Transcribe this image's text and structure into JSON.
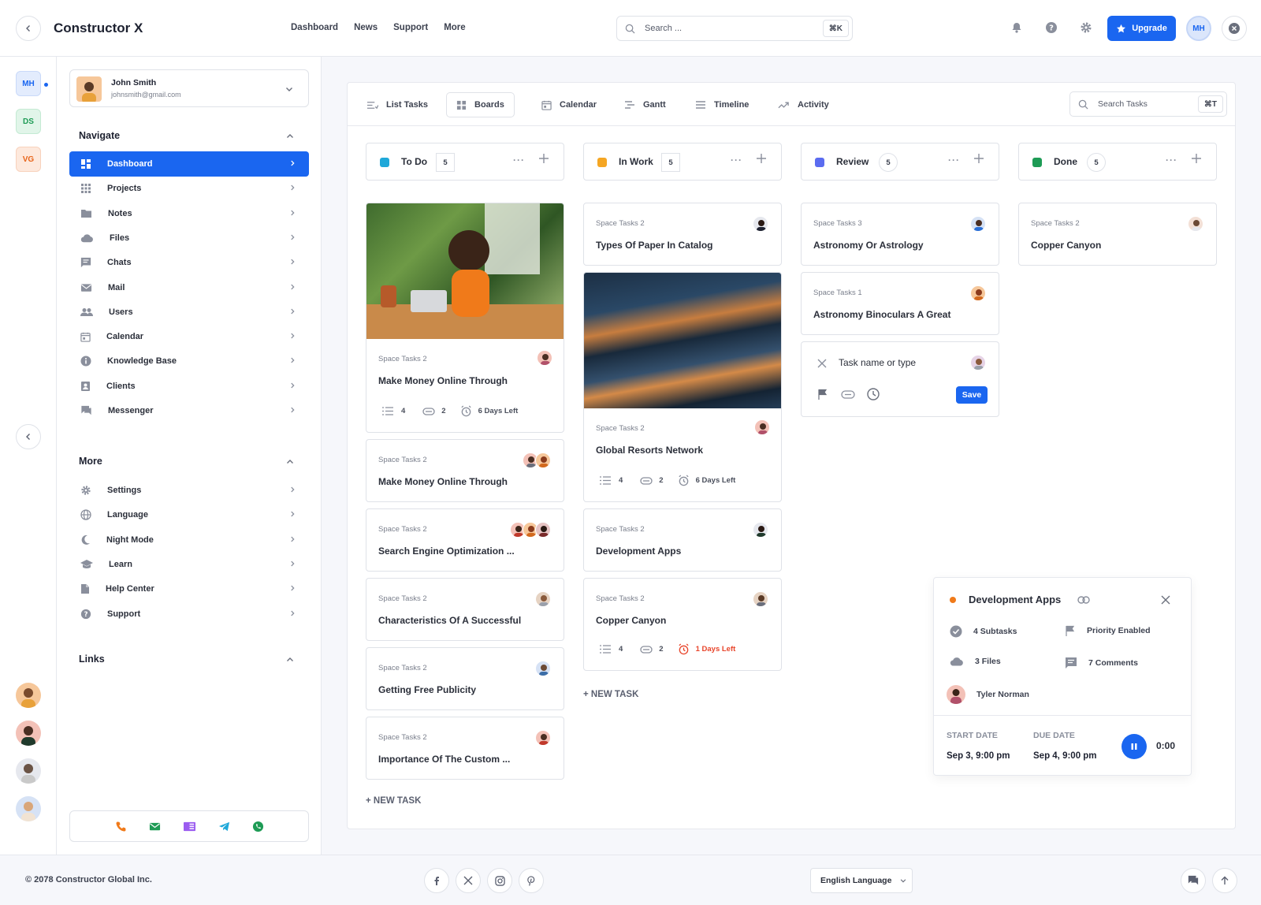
{
  "app": {
    "title": "Constructor X"
  },
  "topnav": [
    "Dashboard",
    "News",
    "Support",
    "More"
  ],
  "search": {
    "placeholder": "Search ...",
    "shortcut": "⌘K"
  },
  "header": {
    "upgrade_label": "Upgrade",
    "user_initials": "MH"
  },
  "workspaces": [
    {
      "label": "MH",
      "color": "#1a66f0",
      "bg": "#e3ecfd"
    },
    {
      "label": "DS",
      "color": "#1e9b55",
      "bg": "#e1f5e9"
    },
    {
      "label": "VG",
      "color": "#e8651a",
      "bg": "#fde9dd"
    }
  ],
  "user": {
    "name": "John Smith",
    "email": "johnsmith@gmail.com"
  },
  "sidebar": {
    "navigate_title": "Navigate",
    "navigate": [
      {
        "label": "Dashboard",
        "icon": "dashboard-icon"
      },
      {
        "label": "Projects",
        "icon": "grid-icon"
      },
      {
        "label": "Notes",
        "icon": "folder-icon"
      },
      {
        "label": "Files",
        "icon": "cloud-icon"
      },
      {
        "label": "Chats",
        "icon": "chat-icon"
      },
      {
        "label": "Mail",
        "icon": "mail-icon"
      },
      {
        "label": "Users",
        "icon": "users-icon"
      },
      {
        "label": "Calendar",
        "icon": "calendar-icon"
      },
      {
        "label": "Knowledge Base",
        "icon": "info-icon"
      },
      {
        "label": "Clients",
        "icon": "contact-icon"
      },
      {
        "label": "Messenger",
        "icon": "messenger-icon"
      }
    ],
    "more_title": "More",
    "more": [
      {
        "label": "Settings",
        "icon": "gear-icon"
      },
      {
        "label": "Language",
        "icon": "globe-icon"
      },
      {
        "label": "Night Mode",
        "icon": "moon-icon"
      },
      {
        "label": "Learn",
        "icon": "school-icon"
      },
      {
        "label": "Help Center",
        "icon": "document-icon"
      },
      {
        "label": "Support",
        "icon": "help-icon"
      }
    ],
    "links_title": "Links"
  },
  "view_tabs": [
    {
      "label": "List Tasks",
      "icon": "list-icon"
    },
    {
      "label": "Boards",
      "icon": "board-icon"
    },
    {
      "label": "Calendar",
      "icon": "calendar-icon"
    },
    {
      "label": "Gantt",
      "icon": "gantt-icon"
    },
    {
      "label": "Timeline",
      "icon": "timeline-icon"
    },
    {
      "label": "Activity",
      "icon": "activity-icon"
    }
  ],
  "task_search": {
    "placeholder": "Search Tasks",
    "shortcut": "⌘T"
  },
  "columns": [
    {
      "title": "To Do",
      "count": "5",
      "color": "#1fa8d9"
    },
    {
      "title": "In Work",
      "count": "5",
      "color": "#f5a623"
    },
    {
      "title": "Review",
      "count": "5",
      "color": "#5b6cf0"
    },
    {
      "title": "Done",
      "count": "5",
      "color": "#1e9b55"
    }
  ],
  "cards": {
    "todo": [
      {
        "space": "Space Tasks 2",
        "title": "Make Money Online Through",
        "subtasks": "4",
        "files": "2",
        "due": "6 Days Left"
      },
      {
        "space": "Space Tasks 2",
        "title": "Make Money Online Through"
      },
      {
        "space": "Space Tasks 2",
        "title": "Search Engine Optimization ..."
      },
      {
        "space": "Space Tasks 2",
        "title": "Characteristics Of A Successful"
      },
      {
        "space": "Space Tasks 2",
        "title": "Getting Free Publicity"
      },
      {
        "space": "Space Tasks 2",
        "title": "Importance Of The Custom ..."
      }
    ],
    "inwork": [
      {
        "space": "Space Tasks 2",
        "title": "Types Of Paper In Catalog"
      },
      {
        "space": "Space Tasks 2",
        "title": "Global Resorts Network",
        "subtasks": "4",
        "files": "2",
        "due": "6 Days Left"
      },
      {
        "space": "Space Tasks 2",
        "title": "Development Apps"
      },
      {
        "space": "Space Tasks 2",
        "title": "Copper Canyon",
        "subtasks": "4",
        "files": "2",
        "due": "1 Days Left"
      }
    ],
    "review": [
      {
        "space": "Space Tasks 3",
        "title": "Astronomy Or Astrology"
      },
      {
        "space": "Space Tasks 1",
        "title": "Astronomy Binoculars A Great"
      }
    ],
    "done": [
      {
        "space": "Space Tasks 2",
        "title": "Copper Canyon"
      }
    ]
  },
  "new_task_input": {
    "placeholder": "Task name or type",
    "save_label": "Save"
  },
  "new_task_label": "+ NEW TASK",
  "popup": {
    "title": "Development Apps",
    "subtasks": "4 Subtasks",
    "priority": "Priority Enabled",
    "files": "3 Files",
    "comments": "7 Comments",
    "assignee": "Tyler Norman",
    "start_label": "START DATE",
    "start_value": "Sep 3, 9:00 pm",
    "due_label": "DUE DATE",
    "due_value": "Sep 4, 9:00 pm",
    "timer": "0:00"
  },
  "footer": {
    "copyright": "© 2078 Constructor Global Inc.",
    "language": "English Language"
  },
  "colors": {
    "accent": "#1a66f0",
    "overdue": "#e8452b"
  }
}
